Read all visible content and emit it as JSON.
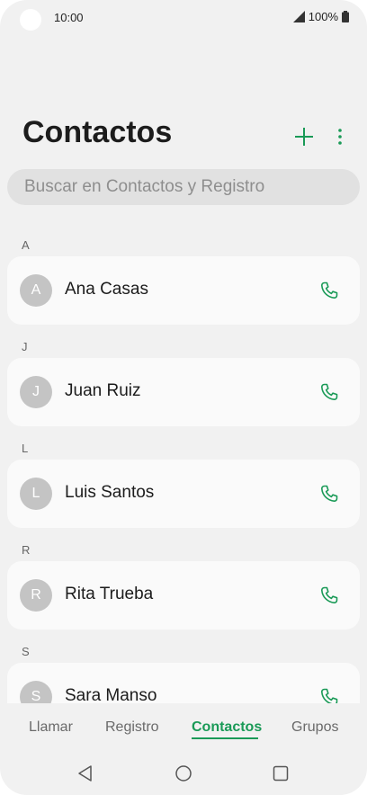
{
  "status_bar": {
    "time": "10:00",
    "battery": "100%"
  },
  "header": {
    "title": "Contactos",
    "add_icon": "plus-icon",
    "more_icon": "more-vertical-icon"
  },
  "search": {
    "placeholder": "Buscar en Contactos y Registro",
    "value": ""
  },
  "contacts": [
    {
      "letter": "A",
      "initial": "A",
      "name": "Ana Casas"
    },
    {
      "letter": "J",
      "initial": "J",
      "name": "Juan Ruiz"
    },
    {
      "letter": "L",
      "initial": "L",
      "name": "Luis Santos"
    },
    {
      "letter": "R",
      "initial": "R",
      "name": "Rita Trueba"
    },
    {
      "letter": "S",
      "initial": "S",
      "name": "Sara Manso"
    }
  ],
  "tabs": [
    {
      "label": "Llamar",
      "active": false
    },
    {
      "label": "Registro",
      "active": false
    },
    {
      "label": "Contactos",
      "active": true
    },
    {
      "label": "Grupos",
      "active": false
    }
  ],
  "nav_bar": {
    "back_icon": "back-triangle-icon",
    "home_icon": "home-circle-icon",
    "recents_icon": "recents-square-icon"
  },
  "colors": {
    "accent": "#1a9a57",
    "background": "#f1f1f1",
    "card": "#fafafa",
    "avatar": "#c4c4c4",
    "search_bg": "#e1e1e1"
  }
}
